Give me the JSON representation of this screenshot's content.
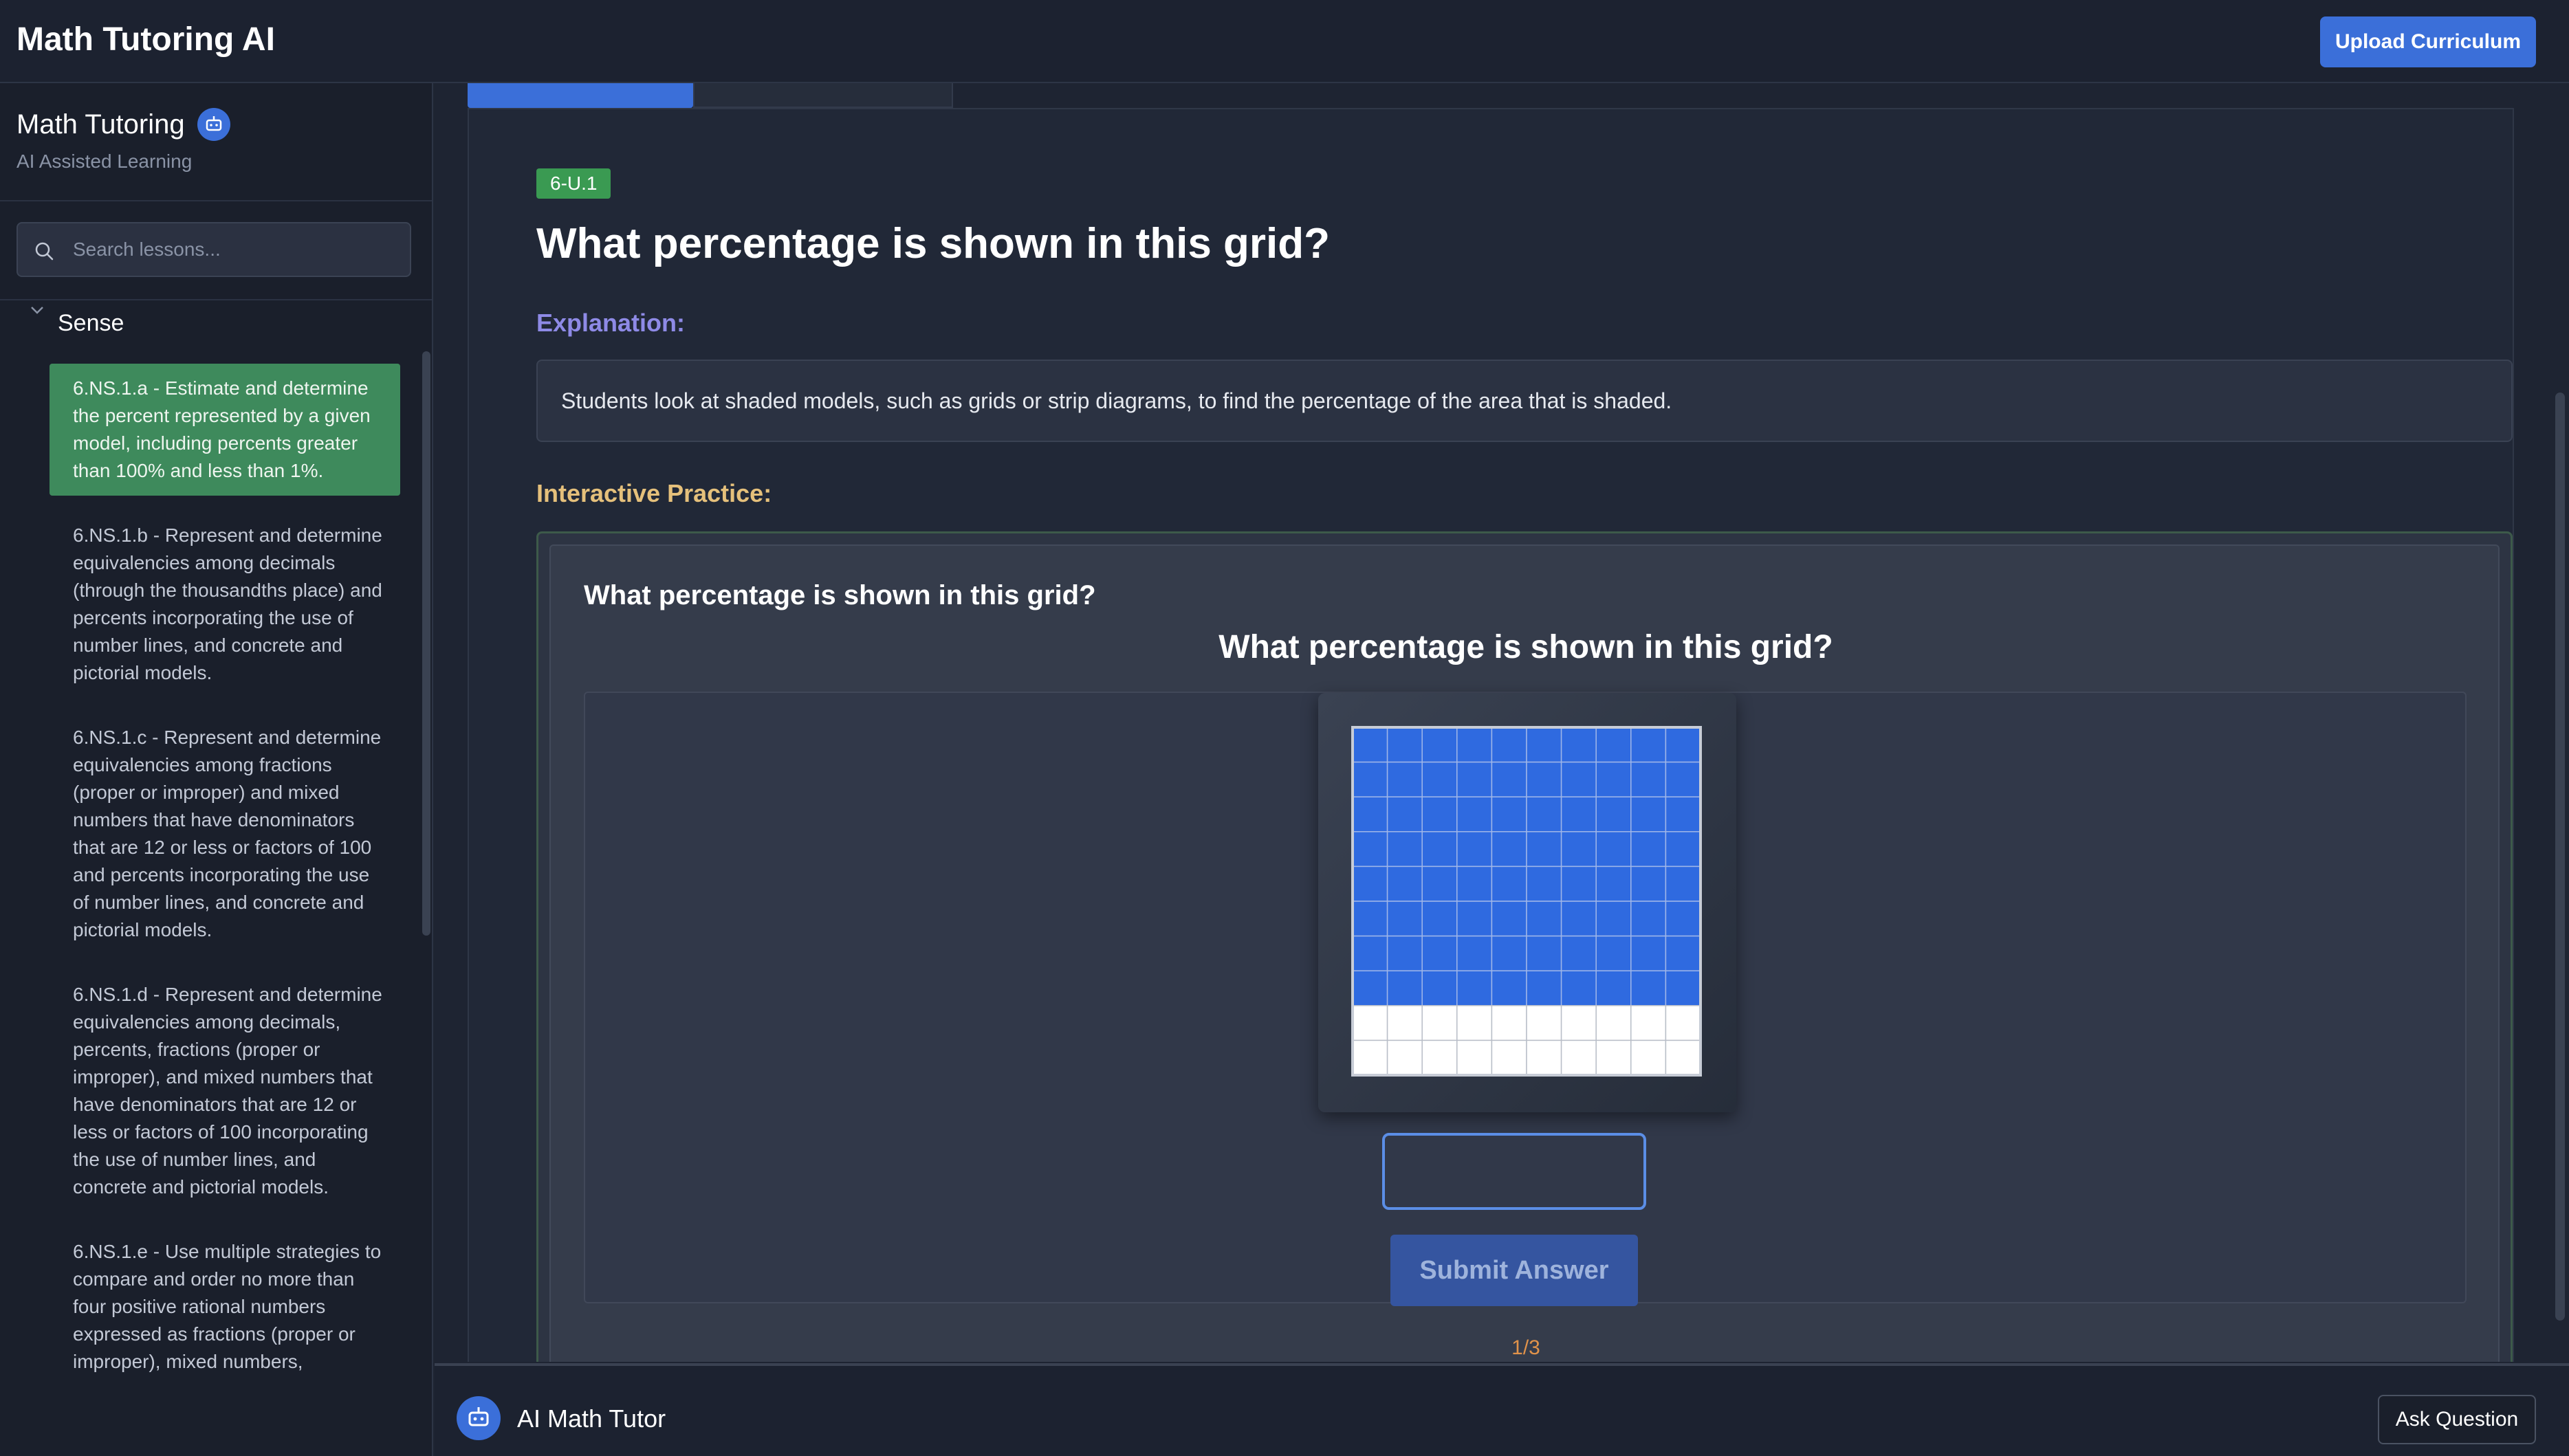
{
  "header": {
    "app_title": "Math Tutoring AI",
    "upload_label": "Upload Curriculum"
  },
  "sidebar": {
    "brand_title": "Math Tutoring",
    "brand_subtitle": "AI Assisted Learning",
    "search_placeholder": "Search lessons...",
    "search_value": "",
    "section_label": "Sense",
    "lessons": [
      {
        "label": "6.NS.1.a - Estimate and determine the percent represented by a given model, including percents greater than 100% and less than 1%.",
        "active": true
      },
      {
        "label": "6.NS.1.b - Represent and determine equivalencies among decimals (through the thousandths place) and percents incorporating the use of number lines, and concrete and pictorial models.",
        "active": false
      },
      {
        "label": "6.NS.1.c - Represent and determine equivalencies among fractions (proper or improper) and mixed numbers that have denominators that are 12 or less or factors of 100 and percents incorporating the use of number lines, and concrete and pictorial models.",
        "active": false
      },
      {
        "label": "6.NS.1.d - Represent and determine equivalencies among decimals, percents, fractions (proper or improper), and mixed numbers that have denominators that are 12 or less or factors of 100 incorporating the use of number lines, and concrete and pictorial models.",
        "active": false
      },
      {
        "label": "6.NS.1.e - Use multiple strategies to compare and order no more than four positive rational numbers expressed as fractions (proper or improper), mixed numbers,",
        "active": false
      }
    ]
  },
  "lesson": {
    "standard_code": "6-U.1",
    "question_title": "What percentage is shown in this grid?",
    "explanation_heading": "Explanation:",
    "explanation_text": "Students look at shaded models, such as grids or strip diagrams, to find the percentage of the area that is shaded.",
    "practice_heading": "Interactive Practice:"
  },
  "practice": {
    "prompt_small": "What percentage is shown in this grid?",
    "prompt_large": "What percentage is shown in this grid?",
    "grid": {
      "rows": 10,
      "cols": 10,
      "shaded_rows": 8,
      "shaded_color": "#2f6ae0",
      "unshaded_color": "#ffffff"
    },
    "answer_value": "",
    "submit_label": "Submit Answer",
    "progress": "1/3"
  },
  "tutor": {
    "label": "AI Math Tutor",
    "ask_label": "Ask Question"
  },
  "colors": {
    "accent": "#3b6fd9",
    "active_lesson": "#3e8a5c",
    "badge": "#3a9a52",
    "explanation_heading": "#8e8ae6",
    "practice_heading": "#e5c07b",
    "progress": "#e0924a"
  }
}
